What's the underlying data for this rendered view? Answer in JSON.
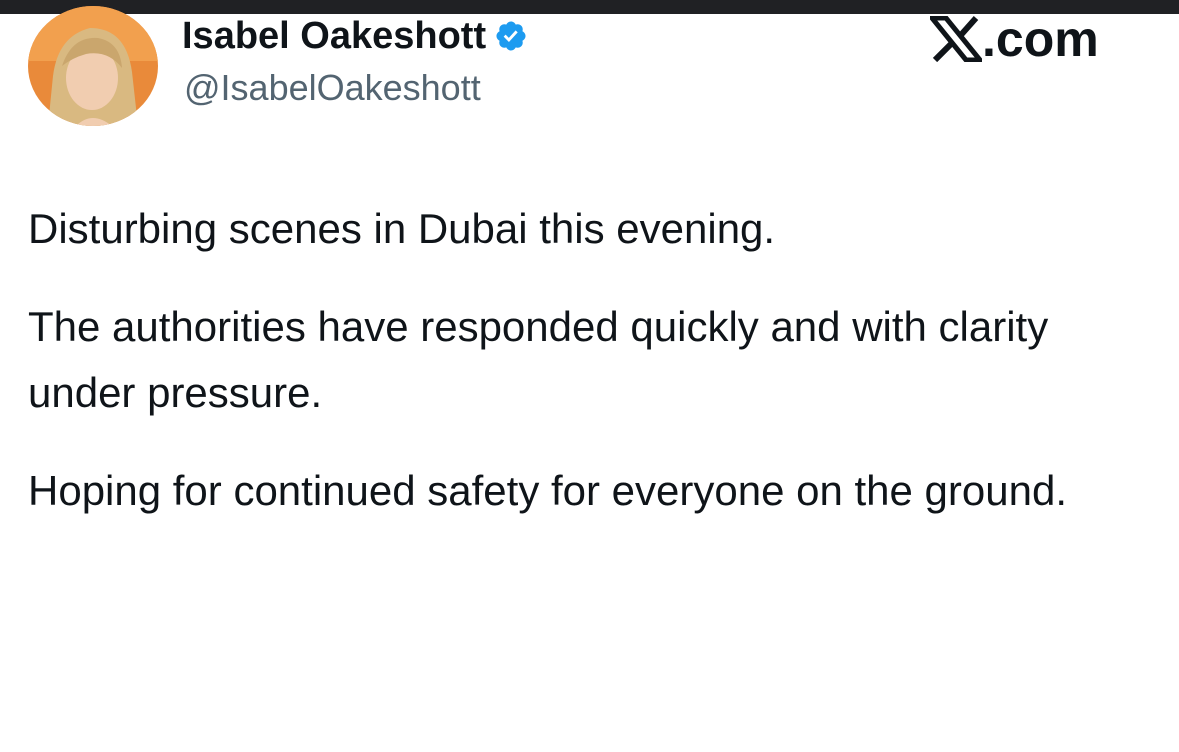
{
  "tweet": {
    "author": {
      "display_name": "Isabel Oakeshott",
      "handle": "@IsabelOakeshott",
      "verified": true,
      "avatar_icon": "profile-photo-avatar"
    },
    "brand": {
      "logo_icon": "x-logo-icon",
      "domain": ".com"
    },
    "paragraphs": [
      "Disturbing scenes in Dubai this evening.",
      "The authorities have responded quickly and with clarity under pressure.",
      "Hoping for continued safety for everyone on the ground."
    ]
  },
  "colors": {
    "text_primary": "#0f1419",
    "text_secondary": "#536471",
    "verified_blue": "#1d9bf0",
    "top_strip": "#202124"
  }
}
